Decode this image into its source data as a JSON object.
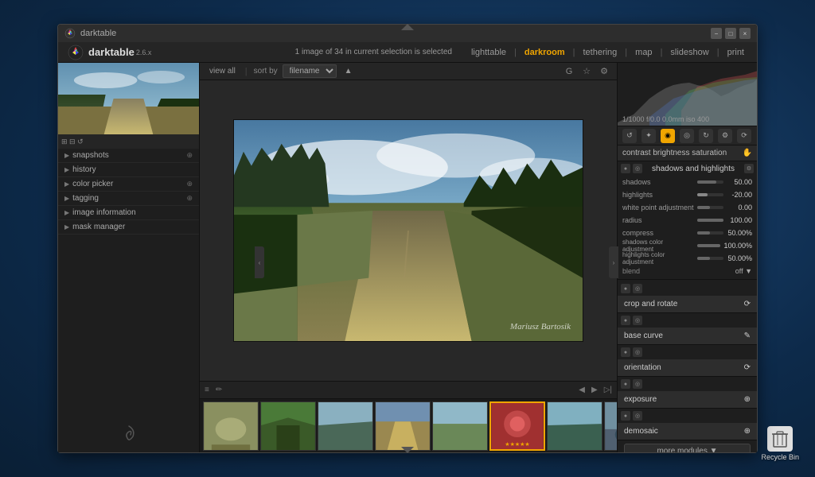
{
  "app": {
    "title": "darktable",
    "version": "2.6.x"
  },
  "titlebar": {
    "minimize": "−",
    "maximize": "□",
    "close": "×"
  },
  "nav": {
    "info": "1 image of 34 in current selection is selected",
    "lighttable": "lighttable",
    "darkroom": "darkroom",
    "tethering": "tethering",
    "map": "map",
    "slideshow": "slideshow",
    "print": "print",
    "separator": "|"
  },
  "toolbar": {
    "view": "view all",
    "sort_by": "sort by",
    "sort_field": "filename",
    "g_btn": "G",
    "star_btn": "☆",
    "gear_btn": "⚙"
  },
  "sidebar_left": {
    "sections": [
      {
        "label": "snapshots",
        "icon": "⊕"
      },
      {
        "label": "history",
        "icon": ""
      },
      {
        "label": "color picker",
        "icon": "⊕"
      },
      {
        "label": "tagging",
        "icon": "⊕"
      },
      {
        "label": "image information",
        "icon": ""
      },
      {
        "label": "mask manager",
        "icon": ""
      }
    ]
  },
  "image": {
    "watermark": "Mariusz Bartosik"
  },
  "histogram": {
    "info": "1/1000  f/0.0  0.0mm  iso 400"
  },
  "module_tools": {
    "icons": [
      "↺",
      "✦",
      "◉",
      "◎",
      "↻",
      "⚙",
      "⟳"
    ]
  },
  "active_module": {
    "name": "contrast brightness saturation",
    "subname": "shadows and highlights"
  },
  "params": {
    "shadows": {
      "label": "shadows",
      "value": "50.00",
      "pct": 75
    },
    "highlights": {
      "label": "highlights",
      "value": "-20.00",
      "pct": 40
    },
    "whitepoint": {
      "label": "white point adjustment",
      "value": "0.00",
      "pct": 50
    },
    "radius": {
      "label": "radius",
      "value": "100.00",
      "pct": 100
    },
    "compress": {
      "label": "compress",
      "value": "50.00%",
      "pct": 50
    },
    "shadows_color": {
      "label": "shadows color adjustment",
      "value": "100.00%",
      "pct": 100
    },
    "highlights_color": {
      "label": "highlights color adjustment",
      "value": "50.00%",
      "pct": 50
    }
  },
  "blend": {
    "label": "blend",
    "value": "off ▼"
  },
  "modules": [
    {
      "label": "crop and rotate",
      "icons": "⟳"
    },
    {
      "label": "base curve",
      "icons": "✎"
    },
    {
      "label": "orientation",
      "icons": "⟳"
    },
    {
      "label": "exposure",
      "icons": "⊕"
    },
    {
      "label": "demosaic",
      "icons": "⊕"
    }
  ],
  "more_modules": "more modules ▼",
  "filmstrip": {
    "items": [
      {
        "color": "#8a9a5a",
        "label": "",
        "active": false
      },
      {
        "color": "#4a7a3a",
        "label": "",
        "active": false
      },
      {
        "color": "#7a9a8a",
        "label": "",
        "active": false
      },
      {
        "color": "#9a8a5a",
        "label": "",
        "active": false
      },
      {
        "color": "#8a9a7a",
        "label": "",
        "active": false
      },
      {
        "color": "#c04040",
        "label": "★★★★★",
        "active": true
      },
      {
        "color": "#5a8a6a",
        "label": "",
        "active": false
      },
      {
        "color": "#607890",
        "label": "",
        "active": false
      },
      {
        "color": "#8a7a5a",
        "label": "",
        "active": false
      },
      {
        "color": "#5a7a8a",
        "label": "",
        "active": false
      },
      {
        "color": "#9a9a5a",
        "label": "",
        "active": false
      }
    ]
  },
  "recycle_bin": {
    "label": "Recycle Bin"
  },
  "filmstrip_icons": [
    "≡",
    "✏"
  ]
}
